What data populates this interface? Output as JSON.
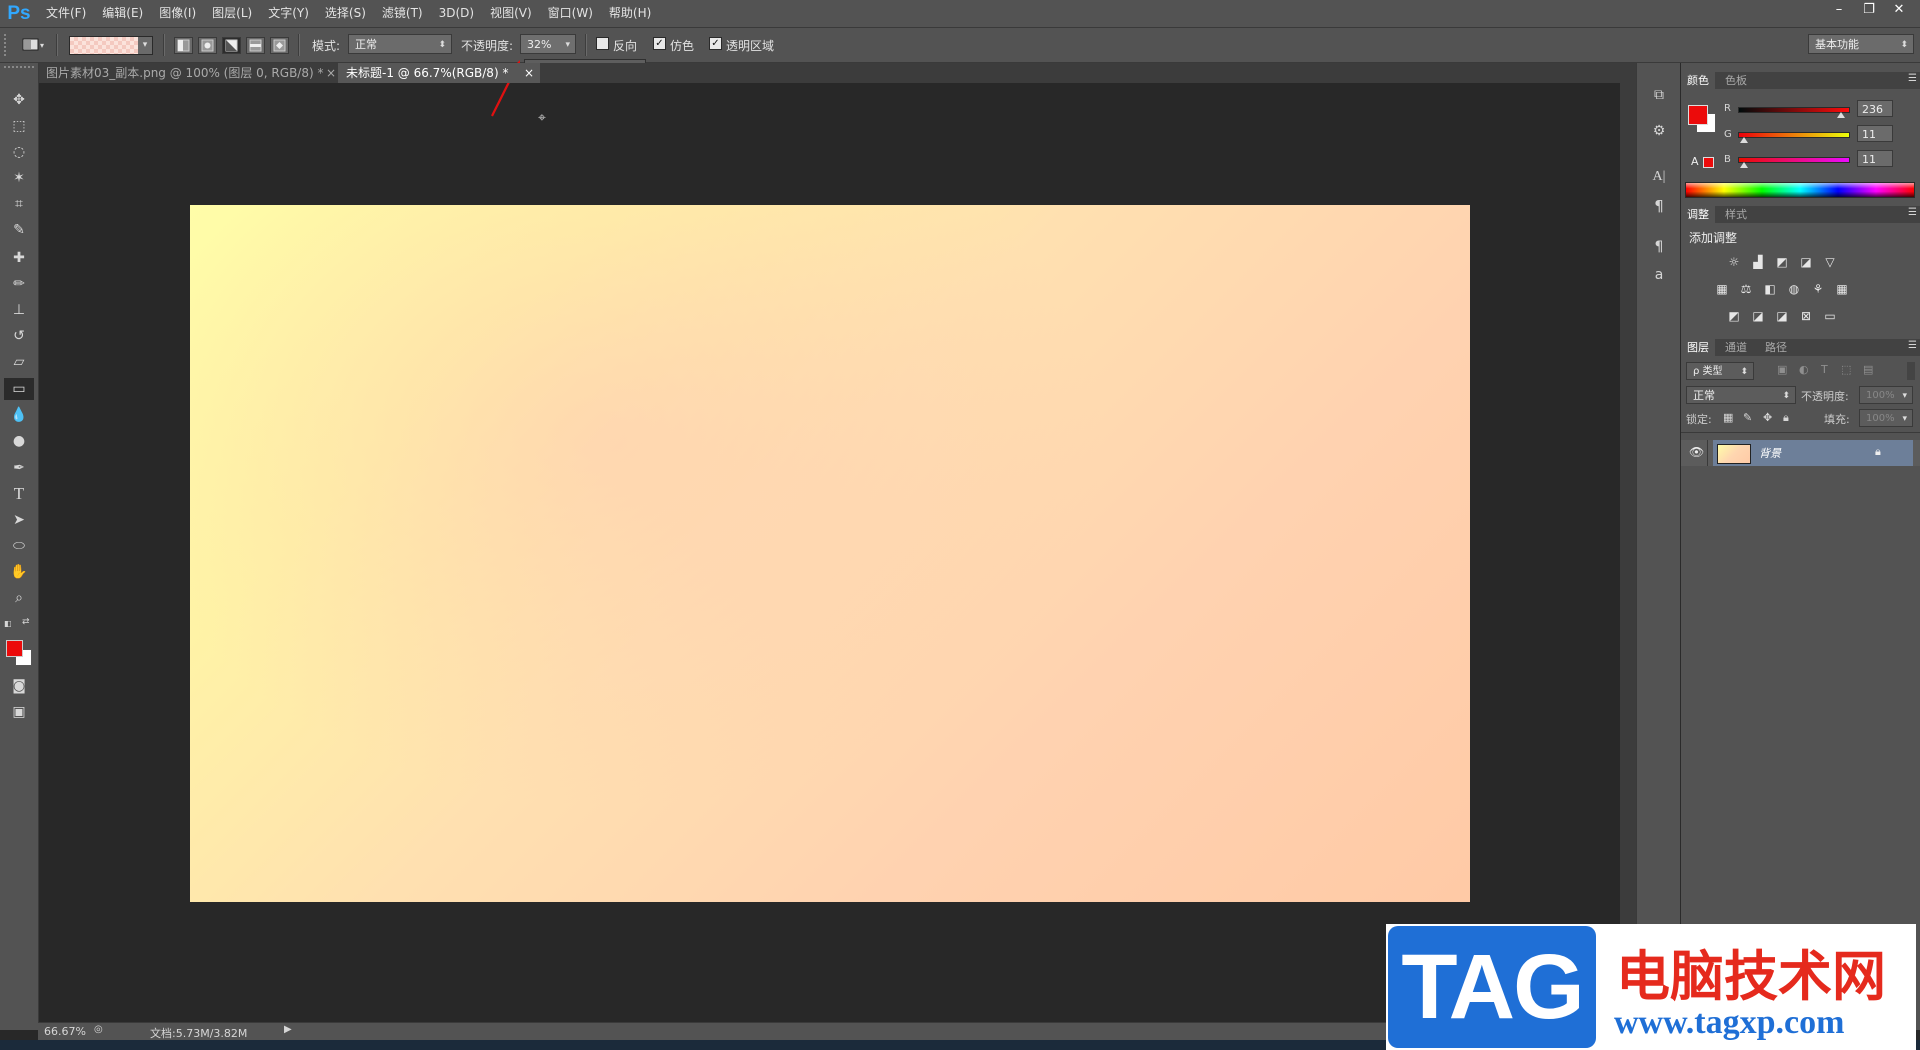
{
  "app": {
    "logo": "Ps"
  },
  "menu": [
    "文件(F)",
    "编辑(E)",
    "图像(I)",
    "图层(L)",
    "文字(Y)",
    "选择(S)",
    "滤镜(T)",
    "3D(D)",
    "视图(V)",
    "窗口(W)",
    "帮助(H)"
  ],
  "window_controls": {
    "minimize": "–",
    "restore": "❐",
    "close": "✕"
  },
  "options": {
    "mode_label": "模式:",
    "mode_value": "正常",
    "opacity_label": "不透明度:",
    "opacity_value": "32%",
    "opacity_slider_level": 0.32,
    "reverse_label": "反向",
    "dither_label": "仿色",
    "transparency_label": "透明区域",
    "workspace": "基本功能"
  },
  "tabs": [
    {
      "label": "图片素材03_副本.png @ 100% (图层 0, RGB/8) *",
      "close": "×",
      "active": false
    },
    {
      "label": "未标题-1 @ 66.7%(RGB/8) *",
      "close": "×",
      "active": true
    }
  ],
  "colors": {
    "accent": "#31a8ff",
    "foreground": "#ec0b0b",
    "background": "#ffffff",
    "annotation_arrow": "#e01010"
  },
  "color_panel": {
    "tabs": [
      "颜色",
      "色板"
    ],
    "channels": [
      {
        "name": "R",
        "value": "236",
        "level": 0.925
      },
      {
        "name": "G",
        "value": "11",
        "level": 0.043
      },
      {
        "name": "B",
        "value": "11",
        "level": 0.043
      }
    ]
  },
  "adjust_panel": {
    "tabs": [
      "调整",
      "样式"
    ],
    "title": "添加调整"
  },
  "layers_panel": {
    "tabs": [
      "图层",
      "通道",
      "路径"
    ],
    "filter_label": "ρ 类型",
    "blend_mode": "正常",
    "opacity_label": "不透明度:",
    "opacity_value": "100%",
    "lock_label": "锁定:",
    "fill_label": "填充:",
    "fill_value": "100%",
    "layers": [
      {
        "name": "背景",
        "visible": true,
        "locked": true
      }
    ]
  },
  "status": {
    "zoom": "66.67%",
    "doc": "文档:5.73M/3.82M"
  },
  "watermark": {
    "tag": "TAG",
    "cn": "电脑技术网",
    "url": "www.tagxp.com"
  }
}
